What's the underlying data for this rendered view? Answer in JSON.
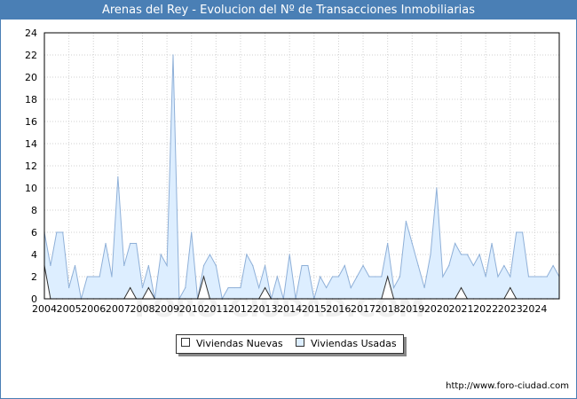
{
  "title": "Arenas del Rey - Evolucion del Nº de Transacciones Inmobiliarias",
  "footer": "http://www.foro-ciudad.com",
  "watermark": "FORO-CIUDAD.COM",
  "colors": {
    "title_bg": "#4a7fb5",
    "usadas_fill": "#ddeeff",
    "usadas_line": "#8fb0d8",
    "nuevas_fill": "#ffffff",
    "nuevas_line": "#333333",
    "grid": "#d0d0d0"
  },
  "chart_data": {
    "type": "area",
    "title": "Arenas del Rey - Evolucion del Nº de Transacciones Inmobiliarias",
    "xlabel": "",
    "ylabel": "",
    "ylim": [
      0,
      24
    ],
    "yticks": [
      0,
      2,
      4,
      6,
      8,
      10,
      12,
      14,
      16,
      18,
      20,
      22,
      24
    ],
    "xticks": [
      "2004",
      "2005",
      "2006",
      "2007",
      "2008",
      "2009",
      "2010",
      "2011",
      "2012",
      "2013",
      "2014",
      "2015",
      "2016",
      "2017",
      "2018",
      "2019",
      "2020",
      "2021",
      "2022",
      "2023",
      "2024"
    ],
    "xlim": [
      2004,
      2025
    ],
    "grid": true,
    "legend_position": "bottom-center",
    "series": [
      {
        "name": "Viviendas Usadas",
        "x": [
          2004.0,
          2004.25,
          2004.5,
          2004.75,
          2005.0,
          2005.25,
          2005.5,
          2005.75,
          2006.0,
          2006.25,
          2006.5,
          2006.75,
          2007.0,
          2007.25,
          2007.5,
          2007.75,
          2008.0,
          2008.25,
          2008.5,
          2008.75,
          2009.0,
          2009.25,
          2009.5,
          2009.75,
          2010.0,
          2010.25,
          2010.5,
          2010.75,
          2011.0,
          2011.25,
          2011.5,
          2011.75,
          2012.0,
          2012.25,
          2012.5,
          2012.75,
          2013.0,
          2013.25,
          2013.5,
          2013.75,
          2014.0,
          2014.25,
          2014.5,
          2014.75,
          2015.0,
          2015.25,
          2015.5,
          2015.75,
          2016.0,
          2016.25,
          2016.5,
          2016.75,
          2017.0,
          2017.25,
          2017.5,
          2017.75,
          2018.0,
          2018.25,
          2018.5,
          2018.75,
          2019.0,
          2019.25,
          2019.5,
          2019.75,
          2020.0,
          2020.25,
          2020.5,
          2020.75,
          2021.0,
          2021.25,
          2021.5,
          2021.75,
          2022.0,
          2022.25,
          2022.5,
          2022.75,
          2023.0,
          2023.25,
          2023.5,
          2023.75,
          2024.0,
          2024.25,
          2024.5,
          2024.75,
          2025.0
        ],
        "values": [
          6,
          3,
          6,
          6,
          1,
          3,
          0,
          2,
          2,
          2,
          5,
          2,
          11,
          3,
          5,
          5,
          1,
          3,
          0,
          4,
          3,
          22,
          0,
          1,
          6,
          0,
          3,
          4,
          3,
          0,
          1,
          1,
          1,
          4,
          3,
          1,
          3,
          0,
          2,
          0,
          4,
          0,
          3,
          3,
          0,
          2,
          1,
          2,
          2,
          3,
          1,
          2,
          3,
          2,
          2,
          2,
          5,
          1,
          2,
          7,
          5,
          3,
          1,
          4,
          10,
          2,
          3,
          5,
          4,
          4,
          3,
          4,
          2,
          5,
          2,
          3,
          2,
          6,
          6,
          2,
          2,
          2,
          2,
          3,
          2
        ]
      },
      {
        "name": "Viviendas Nuevas",
        "x": [
          2004.0,
          2004.25,
          2004.5,
          2004.75,
          2005.0,
          2005.25,
          2005.5,
          2005.75,
          2006.0,
          2006.25,
          2006.5,
          2006.75,
          2007.0,
          2007.25,
          2007.5,
          2007.75,
          2008.0,
          2008.25,
          2008.5,
          2008.75,
          2009.0,
          2009.25,
          2009.5,
          2009.75,
          2010.0,
          2010.25,
          2010.5,
          2010.75,
          2011.0,
          2011.25,
          2011.5,
          2011.75,
          2012.0,
          2012.25,
          2012.5,
          2012.75,
          2013.0,
          2013.25,
          2013.5,
          2013.75,
          2014.0,
          2014.25,
          2014.5,
          2014.75,
          2015.0,
          2015.25,
          2015.5,
          2015.75,
          2016.0,
          2016.25,
          2016.5,
          2016.75,
          2017.0,
          2017.25,
          2017.5,
          2017.75,
          2018.0,
          2018.25,
          2018.5,
          2018.75,
          2019.0,
          2019.25,
          2019.5,
          2019.75,
          2020.0,
          2020.25,
          2020.5,
          2020.75,
          2021.0,
          2021.25,
          2021.5,
          2021.75,
          2022.0,
          2022.25,
          2022.5,
          2022.75,
          2023.0,
          2023.25,
          2023.5,
          2023.75,
          2024.0,
          2024.25,
          2024.5,
          2024.75,
          2025.0
        ],
        "values": [
          3,
          0,
          0,
          0,
          0,
          0,
          0,
          0,
          0,
          0,
          0,
          0,
          0,
          0,
          1,
          0,
          0,
          1,
          0,
          0,
          0,
          0,
          0,
          0,
          0,
          0,
          2,
          0,
          0,
          0,
          0,
          0,
          0,
          0,
          0,
          0,
          1,
          0,
          0,
          0,
          0,
          0,
          0,
          0,
          0,
          0,
          0,
          0,
          0,
          0,
          0,
          0,
          0,
          0,
          0,
          0,
          2,
          0,
          0,
          0,
          0,
          0,
          0,
          0,
          0,
          0,
          0,
          0,
          1,
          0,
          0,
          0,
          0,
          0,
          0,
          0,
          1,
          0,
          0,
          0,
          0,
          0,
          0,
          0,
          0
        ]
      }
    ]
  }
}
